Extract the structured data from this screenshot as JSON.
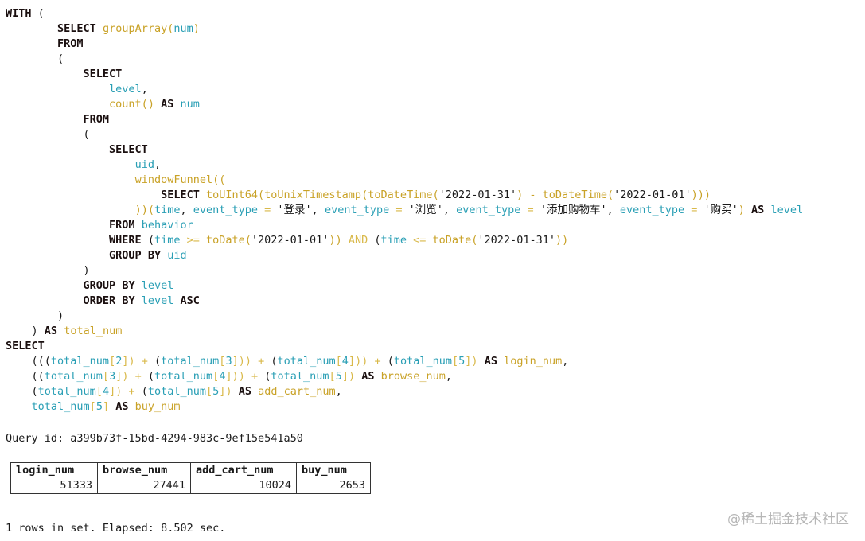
{
  "query_lines": [
    [
      {
        "t": "WITH",
        "c": "kw"
      },
      {
        "t": " (",
        "c": "p"
      }
    ],
    [
      {
        "t": "        ",
        "c": "p"
      },
      {
        "t": "SELECT",
        "c": "kw"
      },
      {
        "t": " ",
        "c": "p"
      },
      {
        "t": "groupArray(",
        "c": "fn"
      },
      {
        "t": "num",
        "c": "id"
      },
      {
        "t": ")",
        "c": "fn"
      }
    ],
    [
      {
        "t": "        ",
        "c": "p"
      },
      {
        "t": "FROM",
        "c": "kw"
      }
    ],
    [
      {
        "t": "        (",
        "c": "p"
      }
    ],
    [
      {
        "t": "            ",
        "c": "p"
      },
      {
        "t": "SELECT",
        "c": "kw"
      }
    ],
    [
      {
        "t": "                ",
        "c": "p"
      },
      {
        "t": "level",
        "c": "id"
      },
      {
        "t": ",",
        "c": "p"
      }
    ],
    [
      {
        "t": "                ",
        "c": "p"
      },
      {
        "t": "count()",
        "c": "fn"
      },
      {
        "t": " ",
        "c": "p"
      },
      {
        "t": "AS",
        "c": "kw"
      },
      {
        "t": " ",
        "c": "p"
      },
      {
        "t": "num",
        "c": "id"
      }
    ],
    [
      {
        "t": "            ",
        "c": "p"
      },
      {
        "t": "FROM",
        "c": "kw"
      }
    ],
    [
      {
        "t": "            (",
        "c": "p"
      }
    ],
    [
      {
        "t": "                ",
        "c": "p"
      },
      {
        "t": "SELECT",
        "c": "kw"
      }
    ],
    [
      {
        "t": "                    ",
        "c": "p"
      },
      {
        "t": "uid",
        "c": "id"
      },
      {
        "t": ",",
        "c": "p"
      }
    ],
    [
      {
        "t": "                    ",
        "c": "p"
      },
      {
        "t": "windowFunnel((",
        "c": "fn"
      }
    ],
    [
      {
        "t": "                        ",
        "c": "p"
      },
      {
        "t": "SELECT",
        "c": "kw"
      },
      {
        "t": " ",
        "c": "p"
      },
      {
        "t": "toUInt64(toUnixTimestamp(toDateTime(",
        "c": "fn"
      },
      {
        "t": "'2022-01-31'",
        "c": "str"
      },
      {
        "t": ") - toDateTime(",
        "c": "fn"
      },
      {
        "t": "'2022-01-01'",
        "c": "str"
      },
      {
        "t": ")))",
        "c": "fn"
      }
    ],
    [
      {
        "t": "                    ",
        "c": "p"
      },
      {
        "t": "))(",
        "c": "fn"
      },
      {
        "t": "time",
        "c": "id"
      },
      {
        "t": ", ",
        "c": "p"
      },
      {
        "t": "event_type",
        "c": "id"
      },
      {
        "t": " = ",
        "c": "op"
      },
      {
        "t": "'登录'",
        "c": "str"
      },
      {
        "t": ", ",
        "c": "p"
      },
      {
        "t": "event_type",
        "c": "id"
      },
      {
        "t": " = ",
        "c": "op"
      },
      {
        "t": "'浏览'",
        "c": "str"
      },
      {
        "t": ", ",
        "c": "p"
      },
      {
        "t": "event_type",
        "c": "id"
      },
      {
        "t": " = ",
        "c": "op"
      },
      {
        "t": "'添加购物车'",
        "c": "str"
      },
      {
        "t": ", ",
        "c": "p"
      },
      {
        "t": "event_type",
        "c": "id"
      },
      {
        "t": " = ",
        "c": "op"
      },
      {
        "t": "'购买'",
        "c": "str"
      },
      {
        "t": ") ",
        "c": "fn"
      },
      {
        "t": "AS",
        "c": "kw"
      },
      {
        "t": " ",
        "c": "p"
      },
      {
        "t": "level",
        "c": "id"
      }
    ],
    [
      {
        "t": "                ",
        "c": "p"
      },
      {
        "t": "FROM",
        "c": "kw"
      },
      {
        "t": " ",
        "c": "p"
      },
      {
        "t": "behavior",
        "c": "id"
      }
    ],
    [
      {
        "t": "                ",
        "c": "p"
      },
      {
        "t": "WHERE",
        "c": "kw"
      },
      {
        "t": " (",
        "c": "p"
      },
      {
        "t": "time",
        "c": "id"
      },
      {
        "t": " >= ",
        "c": "op"
      },
      {
        "t": "toDate(",
        "c": "fn"
      },
      {
        "t": "'2022-01-01'",
        "c": "str"
      },
      {
        "t": "))",
        "c": "fn"
      },
      {
        "t": " AND ",
        "c": "op"
      },
      {
        "t": "(",
        "c": "p"
      },
      {
        "t": "time",
        "c": "id"
      },
      {
        "t": " <= ",
        "c": "op"
      },
      {
        "t": "toDate(",
        "c": "fn"
      },
      {
        "t": "'2022-01-31'",
        "c": "str"
      },
      {
        "t": "))",
        "c": "fn"
      }
    ],
    [
      {
        "t": "                ",
        "c": "p"
      },
      {
        "t": "GROUP BY",
        "c": "kw"
      },
      {
        "t": " ",
        "c": "p"
      },
      {
        "t": "uid",
        "c": "id"
      }
    ],
    [
      {
        "t": "            )",
        "c": "p"
      }
    ],
    [
      {
        "t": "            ",
        "c": "p"
      },
      {
        "t": "GROUP BY",
        "c": "kw"
      },
      {
        "t": " ",
        "c": "p"
      },
      {
        "t": "level",
        "c": "id"
      }
    ],
    [
      {
        "t": "            ",
        "c": "p"
      },
      {
        "t": "ORDER BY",
        "c": "kw"
      },
      {
        "t": " ",
        "c": "p"
      },
      {
        "t": "level",
        "c": "id"
      },
      {
        "t": " ",
        "c": "p"
      },
      {
        "t": "ASC",
        "c": "kw"
      }
    ],
    [
      {
        "t": "        )",
        "c": "p"
      }
    ],
    [
      {
        "t": "    ) ",
        "c": "p"
      },
      {
        "t": "AS",
        "c": "kw"
      },
      {
        "t": " ",
        "c": "p"
      },
      {
        "t": "total_num",
        "c": "fn"
      }
    ],
    [
      {
        "t": "SELECT",
        "c": "kw"
      }
    ],
    [
      {
        "t": "    (((",
        "c": "p"
      },
      {
        "t": "total_num",
        "c": "id"
      },
      {
        "t": "[",
        "c": "op"
      },
      {
        "t": "2",
        "c": "id"
      },
      {
        "t": "])",
        "c": "op"
      },
      {
        "t": " + ",
        "c": "op"
      },
      {
        "t": "(",
        "c": "p"
      },
      {
        "t": "total_num",
        "c": "id"
      },
      {
        "t": "[",
        "c": "op"
      },
      {
        "t": "3",
        "c": "id"
      },
      {
        "t": "]))",
        "c": "op"
      },
      {
        "t": " + ",
        "c": "op"
      },
      {
        "t": "(",
        "c": "p"
      },
      {
        "t": "total_num",
        "c": "id"
      },
      {
        "t": "[",
        "c": "op"
      },
      {
        "t": "4",
        "c": "id"
      },
      {
        "t": "]))",
        "c": "op"
      },
      {
        "t": " + ",
        "c": "op"
      },
      {
        "t": "(",
        "c": "p"
      },
      {
        "t": "total_num",
        "c": "id"
      },
      {
        "t": "[",
        "c": "op"
      },
      {
        "t": "5",
        "c": "id"
      },
      {
        "t": "])",
        "c": "op"
      },
      {
        "t": " ",
        "c": "p"
      },
      {
        "t": "AS",
        "c": "kw"
      },
      {
        "t": " ",
        "c": "p"
      },
      {
        "t": "login_num",
        "c": "fn"
      },
      {
        "t": ",",
        "c": "p"
      }
    ],
    [
      {
        "t": "    ((",
        "c": "p"
      },
      {
        "t": "total_num",
        "c": "id"
      },
      {
        "t": "[",
        "c": "op"
      },
      {
        "t": "3",
        "c": "id"
      },
      {
        "t": "])",
        "c": "op"
      },
      {
        "t": " + ",
        "c": "op"
      },
      {
        "t": "(",
        "c": "p"
      },
      {
        "t": "total_num",
        "c": "id"
      },
      {
        "t": "[",
        "c": "op"
      },
      {
        "t": "4",
        "c": "id"
      },
      {
        "t": "]))",
        "c": "op"
      },
      {
        "t": " + ",
        "c": "op"
      },
      {
        "t": "(",
        "c": "p"
      },
      {
        "t": "total_num",
        "c": "id"
      },
      {
        "t": "[",
        "c": "op"
      },
      {
        "t": "5",
        "c": "id"
      },
      {
        "t": "])",
        "c": "op"
      },
      {
        "t": " ",
        "c": "p"
      },
      {
        "t": "AS",
        "c": "kw"
      },
      {
        "t": " ",
        "c": "p"
      },
      {
        "t": "browse_num",
        "c": "fn"
      },
      {
        "t": ",",
        "c": "p"
      }
    ],
    [
      {
        "t": "    (",
        "c": "p"
      },
      {
        "t": "total_num",
        "c": "id"
      },
      {
        "t": "[",
        "c": "op"
      },
      {
        "t": "4",
        "c": "id"
      },
      {
        "t": "])",
        "c": "op"
      },
      {
        "t": " + ",
        "c": "op"
      },
      {
        "t": "(",
        "c": "p"
      },
      {
        "t": "total_num",
        "c": "id"
      },
      {
        "t": "[",
        "c": "op"
      },
      {
        "t": "5",
        "c": "id"
      },
      {
        "t": "])",
        "c": "op"
      },
      {
        "t": " ",
        "c": "p"
      },
      {
        "t": "AS",
        "c": "kw"
      },
      {
        "t": " ",
        "c": "p"
      },
      {
        "t": "add_cart_num",
        "c": "fn"
      },
      {
        "t": ",",
        "c": "p"
      }
    ],
    [
      {
        "t": "    ",
        "c": "p"
      },
      {
        "t": "total_num",
        "c": "id"
      },
      {
        "t": "[",
        "c": "op"
      },
      {
        "t": "5",
        "c": "id"
      },
      {
        "t": "]",
        "c": "op"
      },
      {
        "t": " ",
        "c": "p"
      },
      {
        "t": "AS",
        "c": "kw"
      },
      {
        "t": " ",
        "c": "p"
      },
      {
        "t": "buy_num",
        "c": "fn"
      }
    ]
  ],
  "query_id_line": "Query id: a399b73f-15bd-4294-983c-9ef15e541a50",
  "result": {
    "columns": [
      "login_num",
      "browse_num",
      "add_cart_num",
      "buy_num"
    ],
    "rows": [
      [
        "51333",
        "27441",
        "10024",
        "2653"
      ]
    ]
  },
  "footer": "1 rows in set. Elapsed: 8.502 sec.",
  "watermark": "@稀土掘金技术社区"
}
